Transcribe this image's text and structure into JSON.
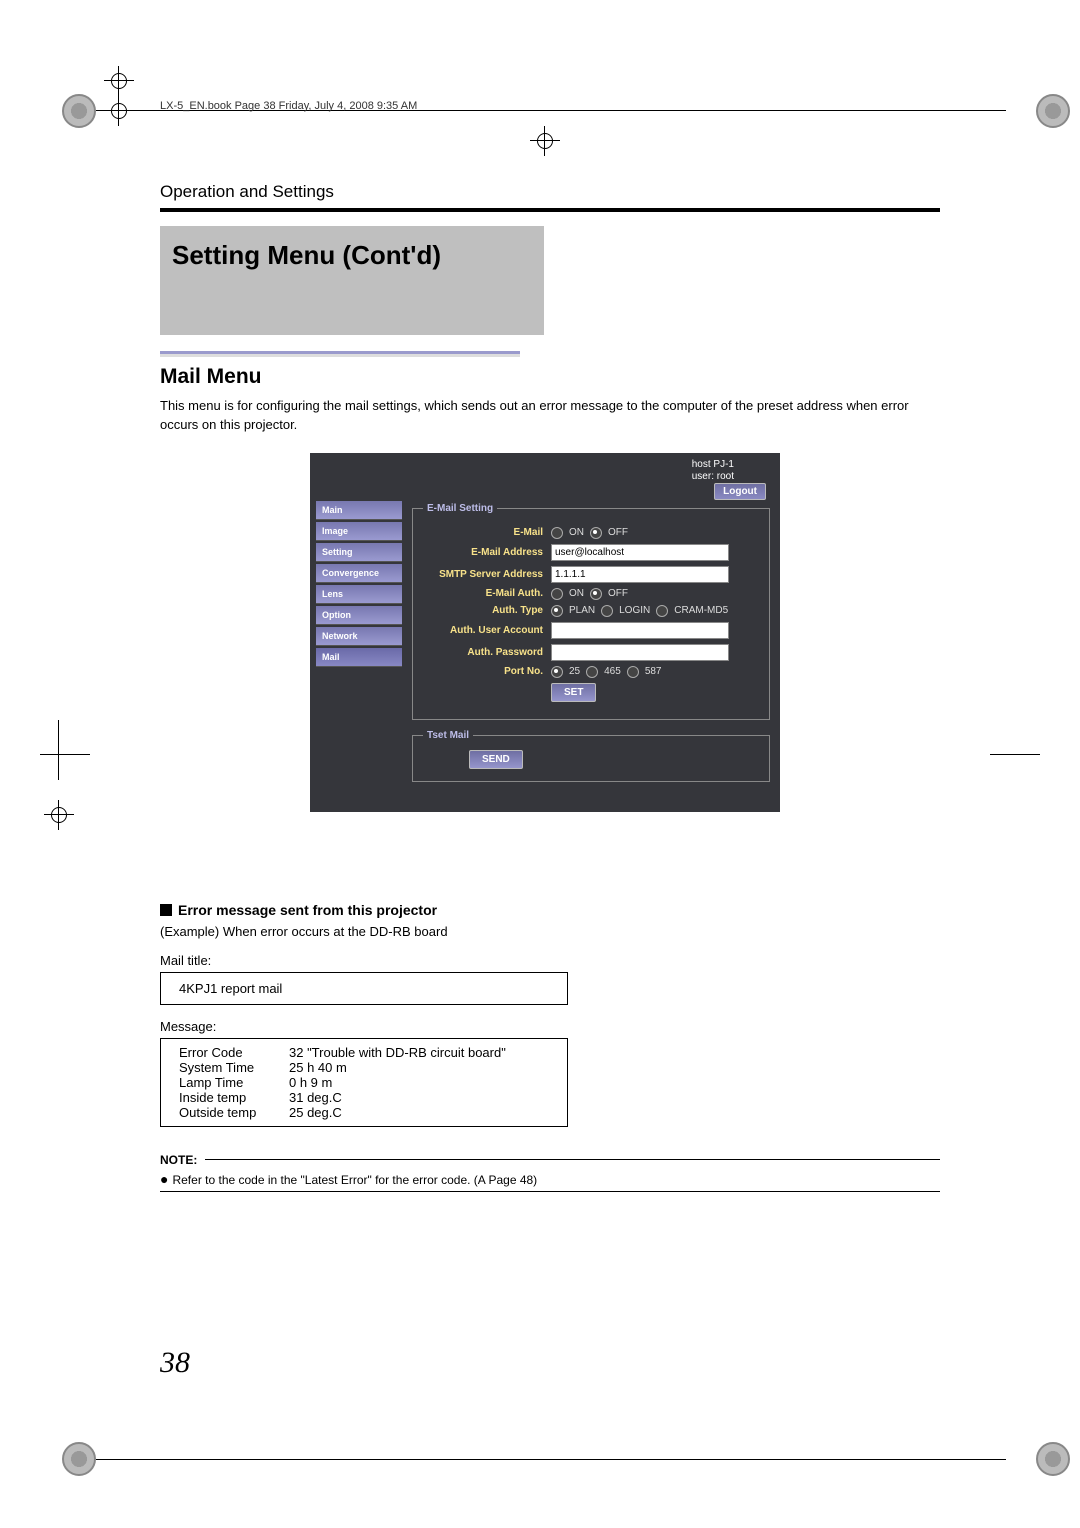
{
  "header_small": "LX-5_EN.book  Page 38  Friday, July 4, 2008  9:35 AM",
  "section_label": "Operation and Settings",
  "title": "Setting Menu (Cont'd)",
  "subsection": "Mail Menu",
  "intro": "This menu is for configuring the mail settings, which sends out an error message to the computer of the preset address when error occurs on this projector.",
  "ui": {
    "host": "host PJ-1",
    "user": "user: root",
    "logout": "Logout",
    "nav": [
      "Main",
      "Image",
      "Setting",
      "Convergence",
      "Lens",
      "Option",
      "Network",
      "Mail"
    ],
    "fieldset1_legend": "E-Mail Setting",
    "rows": {
      "email_label": "E-Mail",
      "email_on": "ON",
      "email_off": "OFF",
      "addr_label": "E-Mail Address",
      "addr_value": "user@localhost",
      "smtp_label": "SMTP Server Address",
      "smtp_value": "1.1.1.1",
      "auth_label": "E-Mail Auth.",
      "auth_on": "ON",
      "auth_off": "OFF",
      "authtype_label": "Auth. Type",
      "authtype_plan": "PLAN",
      "authtype_login": "LOGIN",
      "authtype_cram": "CRAM-MD5",
      "useracct_label": "Auth. User Account",
      "pass_label": "Auth. Password",
      "port_label": "Port No.",
      "port_25": "25",
      "port_465": "465",
      "port_587": "587",
      "set_btn": "SET"
    },
    "fieldset2_legend": "Tset Mail",
    "send_btn": "SEND"
  },
  "error_heading": "Error message sent from this projector",
  "example_line": "(Example) When error occurs at the DD-RB board",
  "mail_title_label": "Mail title:",
  "mail_title_box": "4KPJ1 report mail",
  "message_label": "Message:",
  "message_rows": [
    {
      "k": "Error Code",
      "v": "32 \"Trouble with DD-RB circuit board\""
    },
    {
      "k": "System Time",
      "v": "25 h 40 m"
    },
    {
      "k": "Lamp Time",
      "v": "0 h 9 m"
    },
    {
      "k": "Inside temp",
      "v": "31 deg.C"
    },
    {
      "k": "Outside temp",
      "v": "25 deg.C"
    }
  ],
  "note_label": "NOTE:",
  "note_text": "Refer to the code in the \"Latest Error\" for the error code. (A  Page 48)",
  "page_number": "38"
}
